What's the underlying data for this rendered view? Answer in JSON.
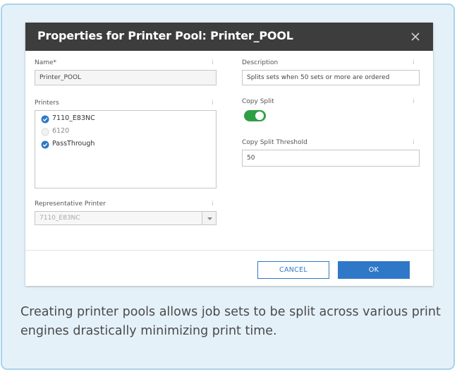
{
  "dialog": {
    "title": "Properties for Printer Pool: Printer_POOL",
    "close_glyph": "×",
    "info_glyph": "i"
  },
  "fields": {
    "name_label": "Name*",
    "name_value": "Printer_POOL",
    "description_label": "Description",
    "description_value": "Splits sets when 50 sets or more are ordered",
    "printers_label": "Printers",
    "copy_split_label": "Copy Split",
    "copy_split_on": true,
    "copy_split_threshold_label": "Copy Split Threshold",
    "copy_split_threshold_value": "50",
    "representative_printer_label": "Representative Printer",
    "representative_printer_value": "7110_E83NC"
  },
  "printers": [
    {
      "name": "7110_E83NC",
      "selected": true
    },
    {
      "name": "6120",
      "selected": false
    },
    {
      "name": "PassThrough",
      "selected": true
    }
  ],
  "buttons": {
    "cancel": "CANCEL",
    "ok": "OK"
  },
  "caption": "Creating printer pools allows job sets to be split across various print engines drastically minimizing print time.",
  "colors": {
    "titlebar": "#3d3d3d",
    "accent": "#2f78c7",
    "toggle_on": "#2ea043",
    "card_bg": "#e5f1f9",
    "card_border": "#a9d2ec"
  }
}
